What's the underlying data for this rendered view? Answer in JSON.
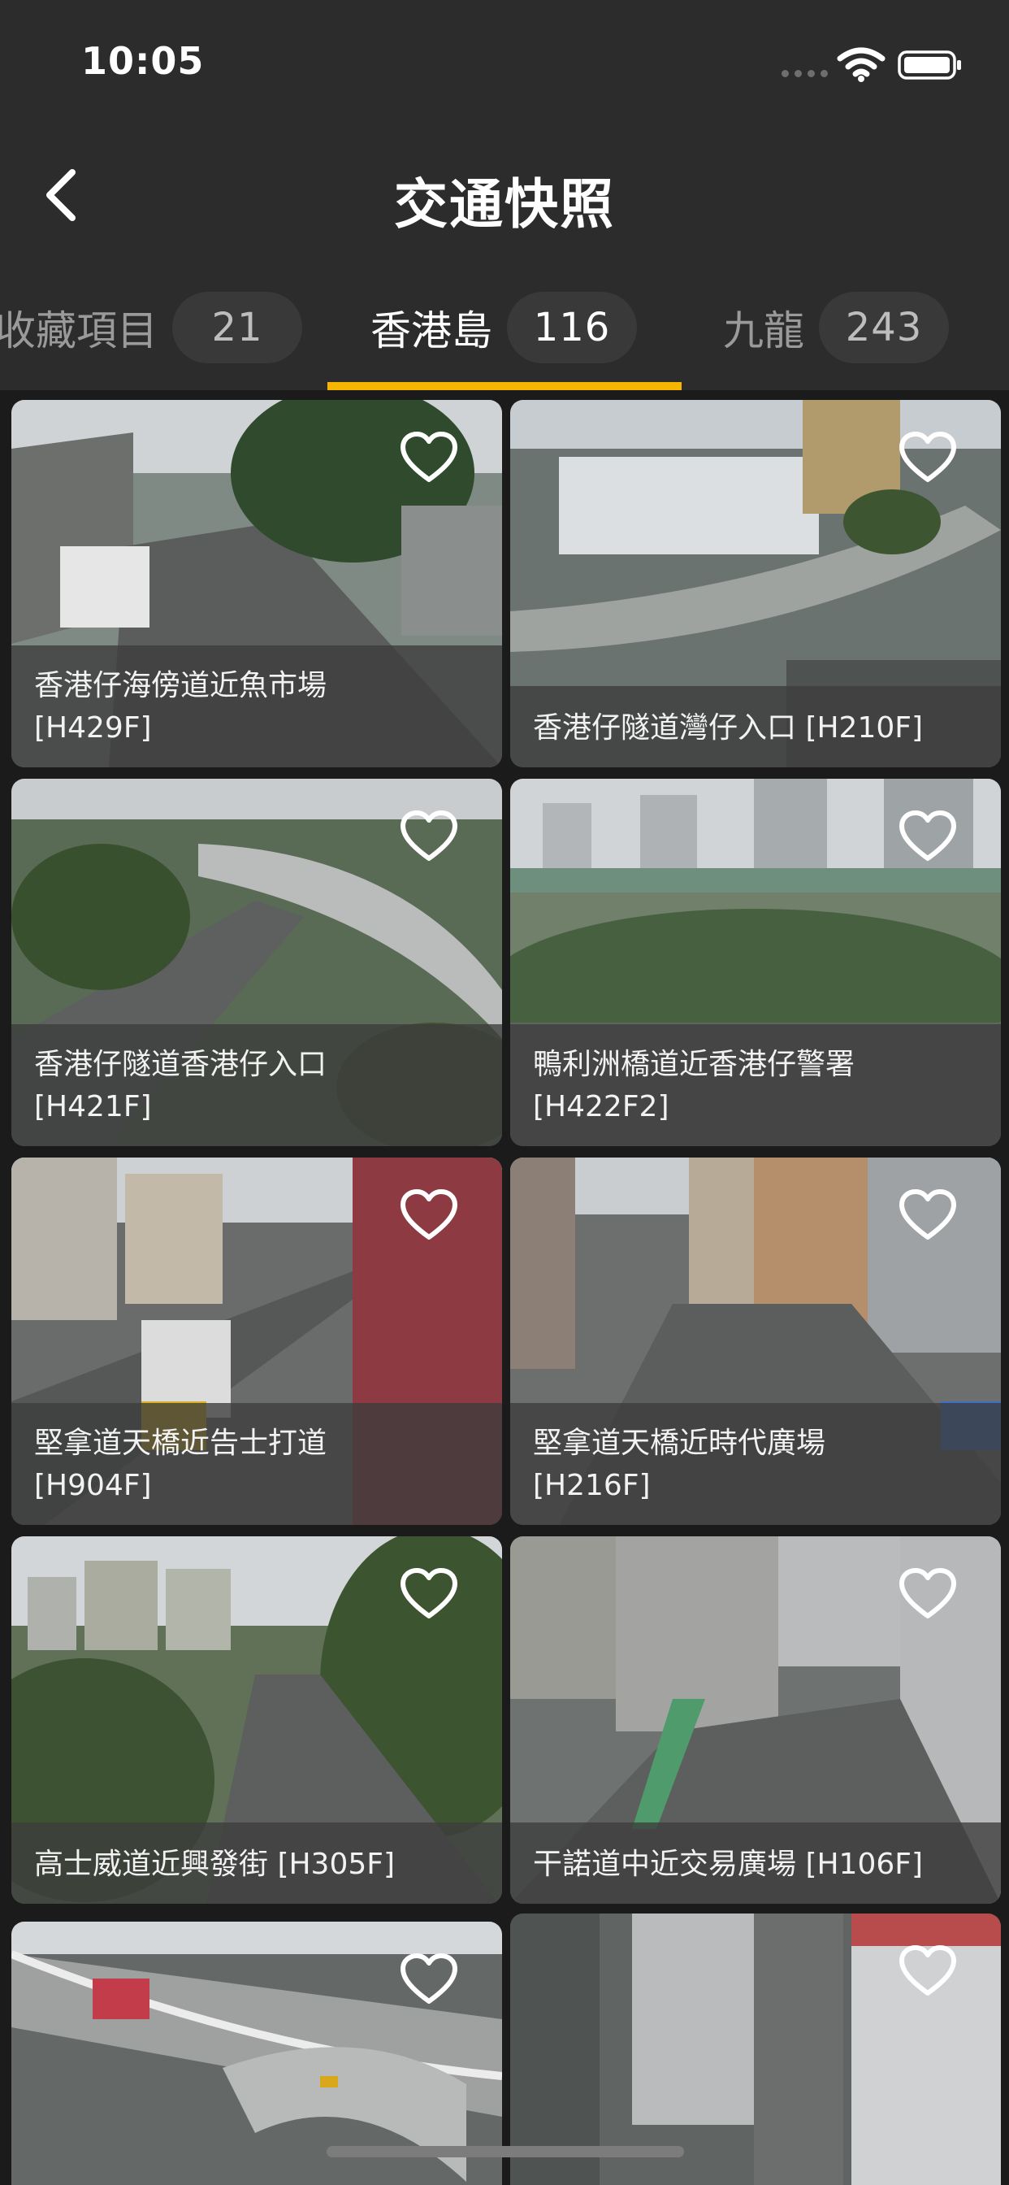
{
  "status_bar": {
    "time": "10:05",
    "icons": [
      "signal-dots-icon",
      "wifi-icon",
      "battery-icon"
    ]
  },
  "header": {
    "title": "交通快照",
    "back_icon": "chevron-left-icon"
  },
  "tabs": [
    {
      "label": "收藏項目",
      "count": "21",
      "active": false
    },
    {
      "label": "香港島",
      "count": "116",
      "active": true
    },
    {
      "label": "九龍",
      "count": "243",
      "active": false
    }
  ],
  "colors": {
    "accent": "#f7b500",
    "background": "#1b1b1b",
    "bar": "#2c2c2c"
  },
  "cameras": [
    {
      "name": "香港仔海傍道近魚市場",
      "code": "[H429F]",
      "favorite_icon": "heart-outline-icon"
    },
    {
      "name": "香港仔隧道灣仔入口 [H210F]",
      "code": "",
      "favorite_icon": "heart-outline-icon"
    },
    {
      "name": "香港仔隧道香港仔入口",
      "code": "[H421F]",
      "favorite_icon": "heart-outline-icon"
    },
    {
      "name": "鴨利洲橋道近香港仔警署",
      "code": "[H422F2]",
      "favorite_icon": "heart-outline-icon"
    },
    {
      "name": "堅拿道天橋近告士打道",
      "code": "[H904F]",
      "favorite_icon": "heart-outline-icon"
    },
    {
      "name": "堅拿道天橋近時代廣場",
      "code": "[H216F]",
      "favorite_icon": "heart-outline-icon"
    },
    {
      "name": "高士威道近興發街 [H305F]",
      "code": "",
      "favorite_icon": "heart-outline-icon"
    },
    {
      "name": "干諾道中近交易廣場 [H106F]",
      "code": "",
      "favorite_icon": "heart-outline-icon"
    },
    {
      "name": "",
      "code": "",
      "favorite_icon": "heart-outline-icon"
    },
    {
      "name": "",
      "code": "",
      "favorite_icon": "heart-outline-icon"
    }
  ]
}
